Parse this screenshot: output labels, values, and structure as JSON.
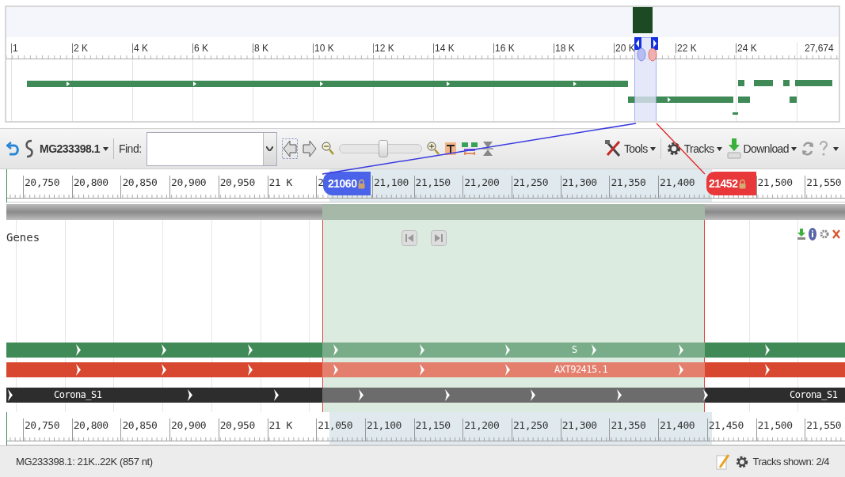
{
  "overview": {
    "ruler_labels": [
      "1",
      "2 K",
      "4 K",
      "6 K",
      "8 K",
      "10 K",
      "12 K",
      "14 K",
      "16 K",
      "18 K",
      "20 K",
      "22 K",
      "24 K",
      "27,674"
    ]
  },
  "toolbar": {
    "sequence": "MG233398.1",
    "find_label": "Find:",
    "zoom": {
      "level": 0.54
    },
    "menus": [
      "Tools",
      "Tracks",
      "Download"
    ]
  },
  "ruler_top": {
    "labels": [
      "20,750",
      "20,800",
      "20,850",
      "20,900",
      "20,950",
      "21 K",
      "2",
      "21,100",
      "21,150",
      "21,200",
      "21,250",
      "21,300",
      "21,350",
      "21,400",
      "21,500",
      "21,550"
    ],
    "start_marker": "21060",
    "end_marker": "21452"
  },
  "track": {
    "title": "Genes"
  },
  "features": [
    {
      "kind": "gene",
      "color": "#3f8a57",
      "labels": [
        "S"
      ]
    },
    {
      "kind": "mrna",
      "color": "#d8472f",
      "labels": [
        "AXT92415.1"
      ]
    },
    {
      "kind": "domain",
      "color": "#2d2d2d",
      "labels": [
        "Corona_S1",
        "Corona_S1"
      ]
    }
  ],
  "ruler_bottom": {
    "labels": [
      "20,750",
      "20,800",
      "20,850",
      "20,900",
      "20,950",
      "21 K",
      "21,050",
      "21,100",
      "21,150",
      "21,200",
      "21,250",
      "21,300",
      "21,350",
      "21,400",
      "21,450",
      "21,500",
      "21,550"
    ]
  },
  "status": {
    "location": "MG233398.1: 21K..22K (857 nt)",
    "tracks_shown": "Tracks shown: 2/4"
  }
}
